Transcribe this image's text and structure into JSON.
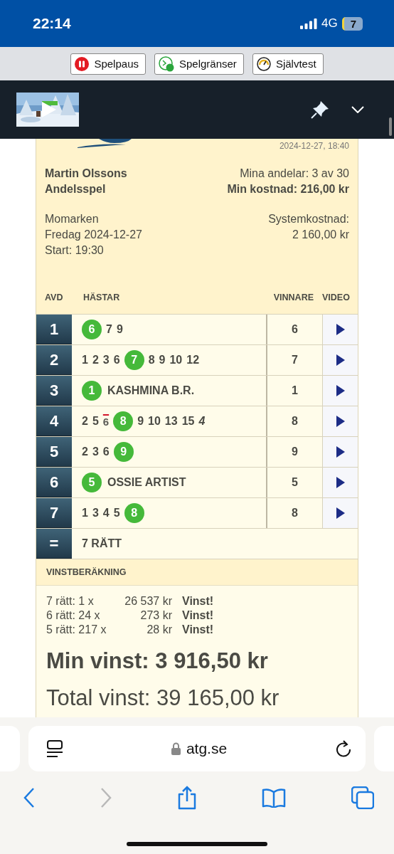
{
  "status_bar": {
    "time": "22:14",
    "network": "4G",
    "battery": "7"
  },
  "rg_buttons": [
    {
      "label": "Spelpaus",
      "kind": "pause"
    },
    {
      "label": "Spelgränser",
      "kind": "limits"
    },
    {
      "label": "Självtest",
      "kind": "test"
    }
  ],
  "coupon": {
    "timestamp": "2024-12-27, 18:40",
    "title": [
      "Martin Olssons",
      "Andelsspel"
    ],
    "shares": "Mina andelar: 3 av 30",
    "my_cost": "Min kostnad: 216,00 kr",
    "track": "Momarken",
    "date": "Fredag 2024-12-27",
    "start": "Start: 19:30",
    "system_cost_label": "Systemkostnad:",
    "system_cost": "2 160,00 kr",
    "columns": [
      "AVD",
      "HÄSTAR",
      "VINNARE",
      "VIDEO"
    ],
    "rows": [
      {
        "avd": "1",
        "horses": [
          {
            "number": "6",
            "kind": "winner"
          },
          {
            "number": "7",
            "kind": "plain"
          },
          {
            "number": "9",
            "kind": "plain"
          }
        ],
        "winner": "6"
      },
      {
        "avd": "2",
        "horses": [
          {
            "number": "1",
            "kind": "plain"
          },
          {
            "number": "2",
            "kind": "plain"
          },
          {
            "number": "3",
            "kind": "plain"
          },
          {
            "number": "6",
            "kind": "plain"
          },
          {
            "number": "7",
            "kind": "winner"
          },
          {
            "number": "8",
            "kind": "plain"
          },
          {
            "number": "9",
            "kind": "plain"
          },
          {
            "number": "10",
            "kind": "plain"
          },
          {
            "number": "12",
            "kind": "plain"
          }
        ],
        "winner": "7"
      },
      {
        "avd": "3",
        "horses": [
          {
            "number": "1",
            "kind": "winner"
          }
        ],
        "horse_name": "KASHMINA B.R.",
        "winner": "1"
      },
      {
        "avd": "4",
        "horses": [
          {
            "number": "2",
            "kind": "plain"
          },
          {
            "number": "5",
            "kind": "plain"
          },
          {
            "number": "6",
            "kind": "scratched"
          },
          {
            "number": "8",
            "kind": "winner"
          },
          {
            "number": "9",
            "kind": "plain"
          },
          {
            "number": "10",
            "kind": "plain"
          },
          {
            "number": "13",
            "kind": "plain"
          },
          {
            "number": "15",
            "kind": "plain"
          },
          {
            "number": "4",
            "kind": "reserve"
          }
        ],
        "winner": "8"
      },
      {
        "avd": "5",
        "horses": [
          {
            "number": "2",
            "kind": "plain"
          },
          {
            "number": "3",
            "kind": "plain"
          },
          {
            "number": "6",
            "kind": "plain"
          },
          {
            "number": "9",
            "kind": "winner"
          }
        ],
        "winner": "9"
      },
      {
        "avd": "6",
        "horses": [
          {
            "number": "5",
            "kind": "winner"
          }
        ],
        "horse_name": "OSSIE ARTIST",
        "winner": "5"
      },
      {
        "avd": "7",
        "horses": [
          {
            "number": "1",
            "kind": "plain"
          },
          {
            "number": "3",
            "kind": "plain"
          },
          {
            "number": "4",
            "kind": "plain"
          },
          {
            "number": "5",
            "kind": "plain"
          },
          {
            "number": "8",
            "kind": "winner"
          }
        ],
        "winner": "8"
      }
    ],
    "result": {
      "symbol": "=",
      "text": "7 RÄTT"
    },
    "prize_heading": "VINSTBERÄKNING",
    "prizes": [
      {
        "label": "7 rätt: 1 x",
        "amount": "26 537 kr",
        "status": "Vinst!"
      },
      {
        "label": "6 rätt: 24 x",
        "amount": "273 kr",
        "status": "Vinst!"
      },
      {
        "label": "5 rätt: 217 x",
        "amount": "28 kr",
        "status": "Vinst!"
      }
    ],
    "my_win": "Min vinst: 3 916,50 kr",
    "total_win": "Total vinst: 39 165,00 kr"
  },
  "browser": {
    "url": "atg.se"
  }
}
